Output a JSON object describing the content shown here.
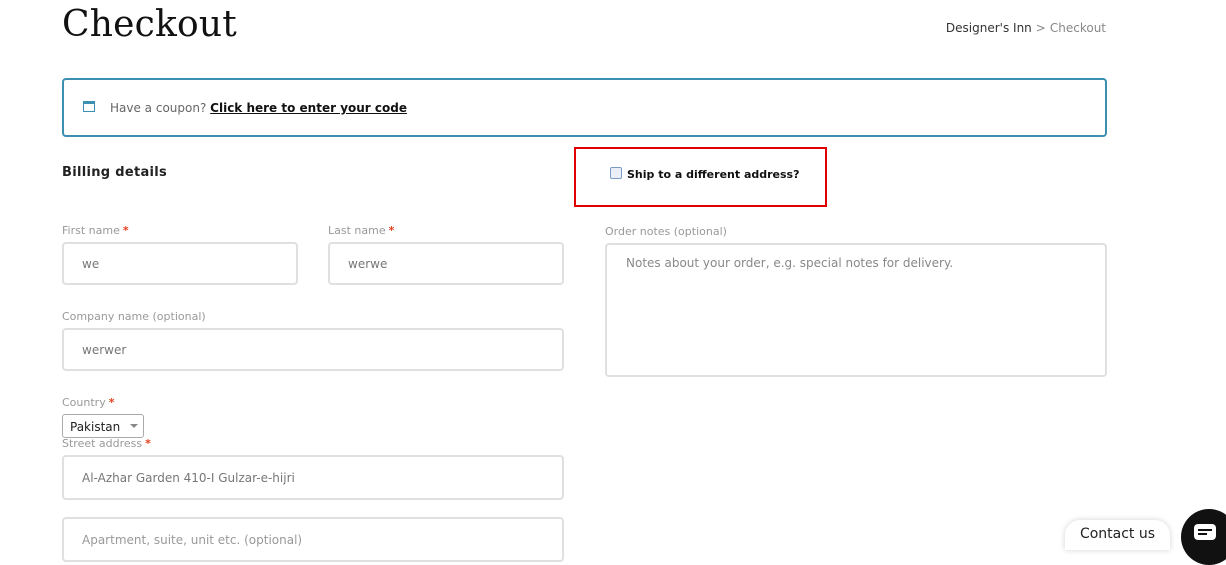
{
  "header": {
    "title": "Checkout",
    "breadcrumb": {
      "home": "Designer's Inn",
      "separator": ">",
      "current": "Checkout"
    }
  },
  "coupon": {
    "prompt": "Have a coupon?",
    "link": "Click here to enter your code",
    "icon": "coupon-icon",
    "accent": "#3d8fb1"
  },
  "billing": {
    "heading": "Billing details",
    "required_mark": "*",
    "first_name": {
      "label": "First name",
      "value": "we"
    },
    "last_name": {
      "label": "Last name",
      "value": "werwe"
    },
    "company": {
      "label": "Company name (optional)",
      "value": "werwer"
    },
    "country": {
      "label": "Country",
      "value": "Pakistan"
    },
    "street": {
      "label": "Street address",
      "value": "Al-Azhar Garden 410-I Gulzar-e-hijri",
      "apartment_placeholder": "Apartment, suite, unit etc. (optional)"
    }
  },
  "shipping": {
    "label": "Ship to a different address?",
    "checked": false,
    "highlight_color": "#e00000"
  },
  "order_notes": {
    "label": "Order notes (optional)",
    "placeholder": "Notes about your order, e.g. special notes for delivery."
  },
  "widget": {
    "contact_label": "Contact us",
    "chat_icon": "chat-bubble-icon"
  },
  "colors": {
    "required": "#e2401c",
    "input_border": "#e0e0e0"
  }
}
